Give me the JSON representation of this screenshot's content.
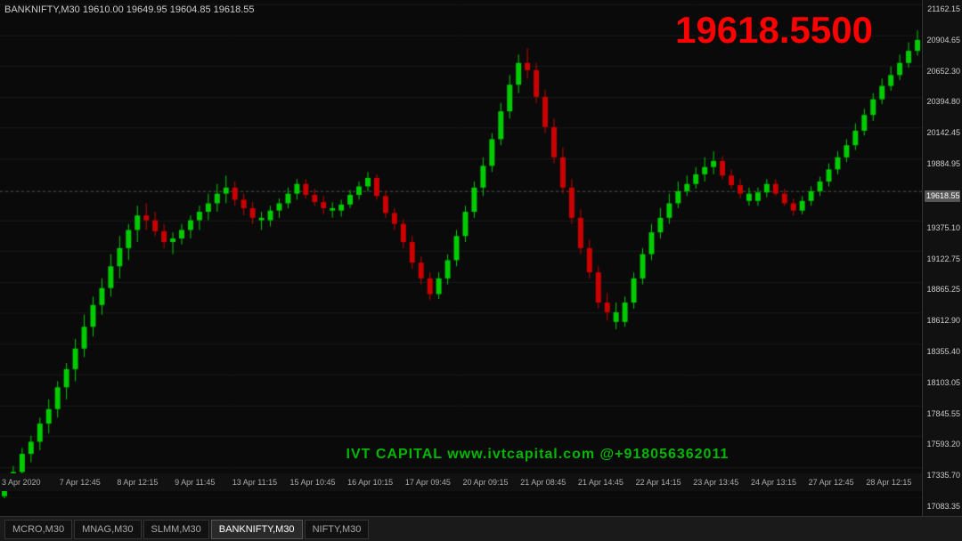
{
  "symbol": {
    "name": "BANKNIFTY,M30",
    "ohlc": "19610.00 19649.95 19604.85 19618.55"
  },
  "currentPrice": "19618.5500",
  "priceAxis": {
    "labels": [
      "21162.15",
      "20904.65",
      "20652.30",
      "20394.80",
      "20142.45",
      "19884.95",
      "19618.55",
      "19375.10",
      "19122.75",
      "18865.25",
      "18612.90",
      "18355.40",
      "18103.05",
      "17845.55",
      "17593.20",
      "17335.70",
      "17083.35"
    ],
    "current": "19618.55"
  },
  "timeAxis": {
    "labels": [
      "3 Apr 2020",
      "7 Apr 12:45",
      "8 Apr 12:15",
      "9 Apr 11:45",
      "13 Apr 11:15",
      "15 Apr 10:45",
      "16 Apr 10:15",
      "17 Apr 09:45",
      "20 Apr 09:15",
      "21 Apr 08:45",
      "21 Apr 14:45",
      "22 Apr 14:15",
      "23 Apr 13:45",
      "24 Apr 13:15",
      "27 Apr 12:45",
      "28 Apr 12:15"
    ]
  },
  "watermark": {
    "text": "IVT CAPITAL  www.ivtcapital.com  @+918056362011"
  },
  "tabs": [
    {
      "label": "MCRO,M30",
      "active": false
    },
    {
      "label": "MNAG,M30",
      "active": false
    },
    {
      "label": "SLMM,M30",
      "active": false
    },
    {
      "label": "BANKNIFTY,M30",
      "active": true
    },
    {
      "label": "NIFTY,M30",
      "active": false
    }
  ],
  "colors": {
    "background": "#0a0a0a",
    "bullish": "#00cc00",
    "bearish": "#cc0000",
    "currentPrice": "#ff0000",
    "gridLine": "#1a1a1a",
    "hLine": "#888888",
    "text": "#cccccc"
  }
}
